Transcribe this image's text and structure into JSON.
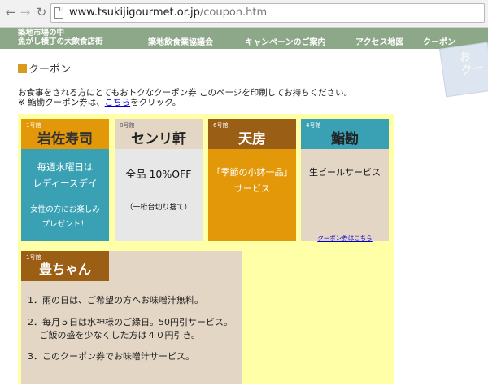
{
  "browser": {
    "url_domain": "www.tsukijigourmet.or.jp",
    "url_path": "/coupon.htm"
  },
  "site": {
    "name_line1": "築地市場の中",
    "name_line2": "魚がし横丁の大飲食店街",
    "nav": [
      "築地飲食業協議会",
      "キャンペーンのご案内",
      "アクセス地図",
      "クーポン"
    ]
  },
  "page": {
    "title": "クーポン",
    "intro_line1": "お食事をされる方にとてもおトクなクーポン券 このページを印刷してお持ちください。",
    "intro_line2_prefix": "※ 鮨勘クーポン券は、",
    "intro_line2_link": "こちら",
    "intro_line2_suffix": "をクリック。",
    "corner_text": "お\nクー"
  },
  "coupons": [
    {
      "num": "1号館",
      "name": "岩佐寿司",
      "lines": [
        "毎週水曜日は",
        "レディースデイ",
        "女性の方にお楽しみ",
        "プレゼント！"
      ]
    },
    {
      "num": "8号館",
      "name": "センリ軒",
      "lines": [
        "全品 10%OFF",
        "（一桁台切り捨て）"
      ]
    },
    {
      "num": "6号館",
      "name": "天房",
      "lines": [
        "「季節の小鉢一品」",
        "サービス"
      ]
    },
    {
      "num": "4号館",
      "name": "鮨勘",
      "lines": [
        "生ビールサービス"
      ],
      "link": "クーポン券はこちら"
    },
    {
      "num": "1号館",
      "name": "豊ちゃん",
      "lines": [
        "1．雨の日は、ご希望の方へお味噌汁無料。",
        "2．毎月５日は水神様のご縁日。50円引サービス。",
        "　 ご飯の盛を少なくした方は４０円引き。",
        "3．このクーポン券でお味噌汁サービス。"
      ]
    }
  ],
  "colors": {
    "header_bg": "#8da888",
    "coupon_area_bg": "#ffffa8",
    "orange": "#e3980a",
    "teal": "#3aa1b4",
    "brown": "#9a5e15",
    "beige": "#e3d6c5"
  }
}
